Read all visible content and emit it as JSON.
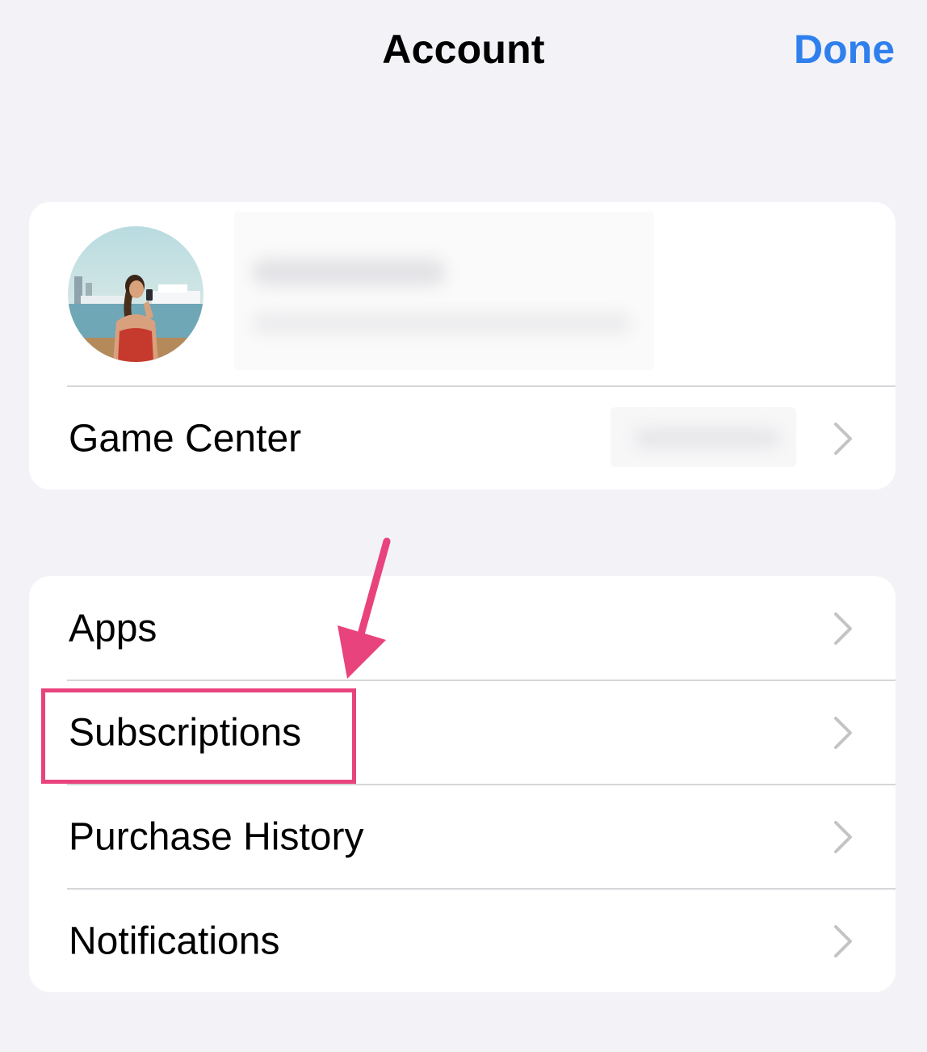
{
  "nav": {
    "title": "Account",
    "done_label": "Done"
  },
  "profile": {
    "name": "",
    "email": ""
  },
  "game_center": {
    "label": "Game Center",
    "value": ""
  },
  "menu": {
    "items": [
      {
        "label": "Apps"
      },
      {
        "label": "Subscriptions"
      },
      {
        "label": "Purchase History"
      },
      {
        "label": "Notifications"
      }
    ]
  },
  "colors": {
    "accent": "#2f80ed",
    "annotation": "#e8437c",
    "background": "#f2f2f7",
    "chevron": "#c4c4c7"
  },
  "annotation": {
    "highlighted_item": "Subscriptions",
    "icon": "arrow-down-icon"
  }
}
